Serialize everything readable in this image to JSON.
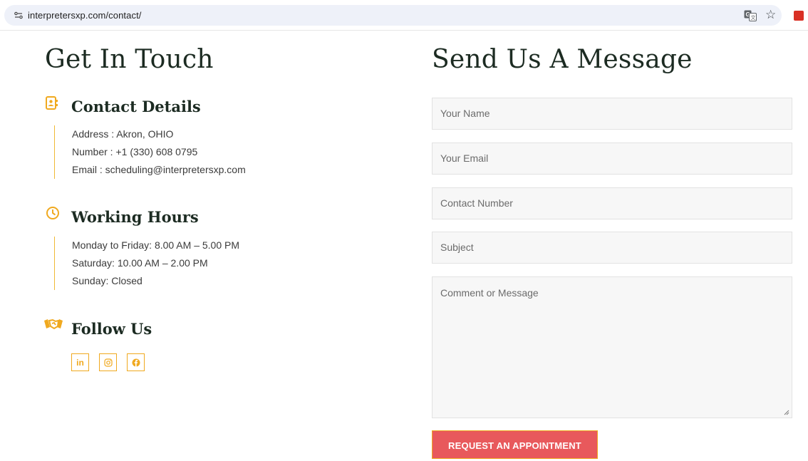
{
  "browser": {
    "url": "interpretersxp.com/contact/"
  },
  "left": {
    "heading": "Get In Touch",
    "contact": {
      "title": "Contact Details",
      "icon": "contact-book-icon",
      "lines": [
        "Address : Akron, OHIO",
        "Number : +1 (330) 608 0795",
        "Email : scheduling@interpretersxp.com"
      ]
    },
    "hours": {
      "title": "Working Hours",
      "icon": "clock-icon",
      "lines": [
        "Monday to Friday: 8.00 AM – 5.00 PM",
        "Saturday: 10.00 AM – 2.00 PM",
        "Sunday: Closed"
      ]
    },
    "follow": {
      "title": "Follow Us",
      "icon": "handshake-icon",
      "social": [
        {
          "icon": "linkedin-icon",
          "glyph": "in"
        },
        {
          "icon": "instagram-icon",
          "glyph": "◎"
        },
        {
          "icon": "facebook-icon",
          "glyph": "f"
        }
      ]
    }
  },
  "form": {
    "heading": "Send Us A Message",
    "name_placeholder": "Your Name",
    "email_placeholder": "Your Email",
    "phone_placeholder": "Contact Number",
    "subject_placeholder": "Subject",
    "message_placeholder": "Comment or Message",
    "submit_label": "REQUEST AN APPOINTMENT"
  },
  "colors": {
    "accent": "#f0a91f",
    "button": "#e8595c",
    "heading": "#1c2b22"
  }
}
